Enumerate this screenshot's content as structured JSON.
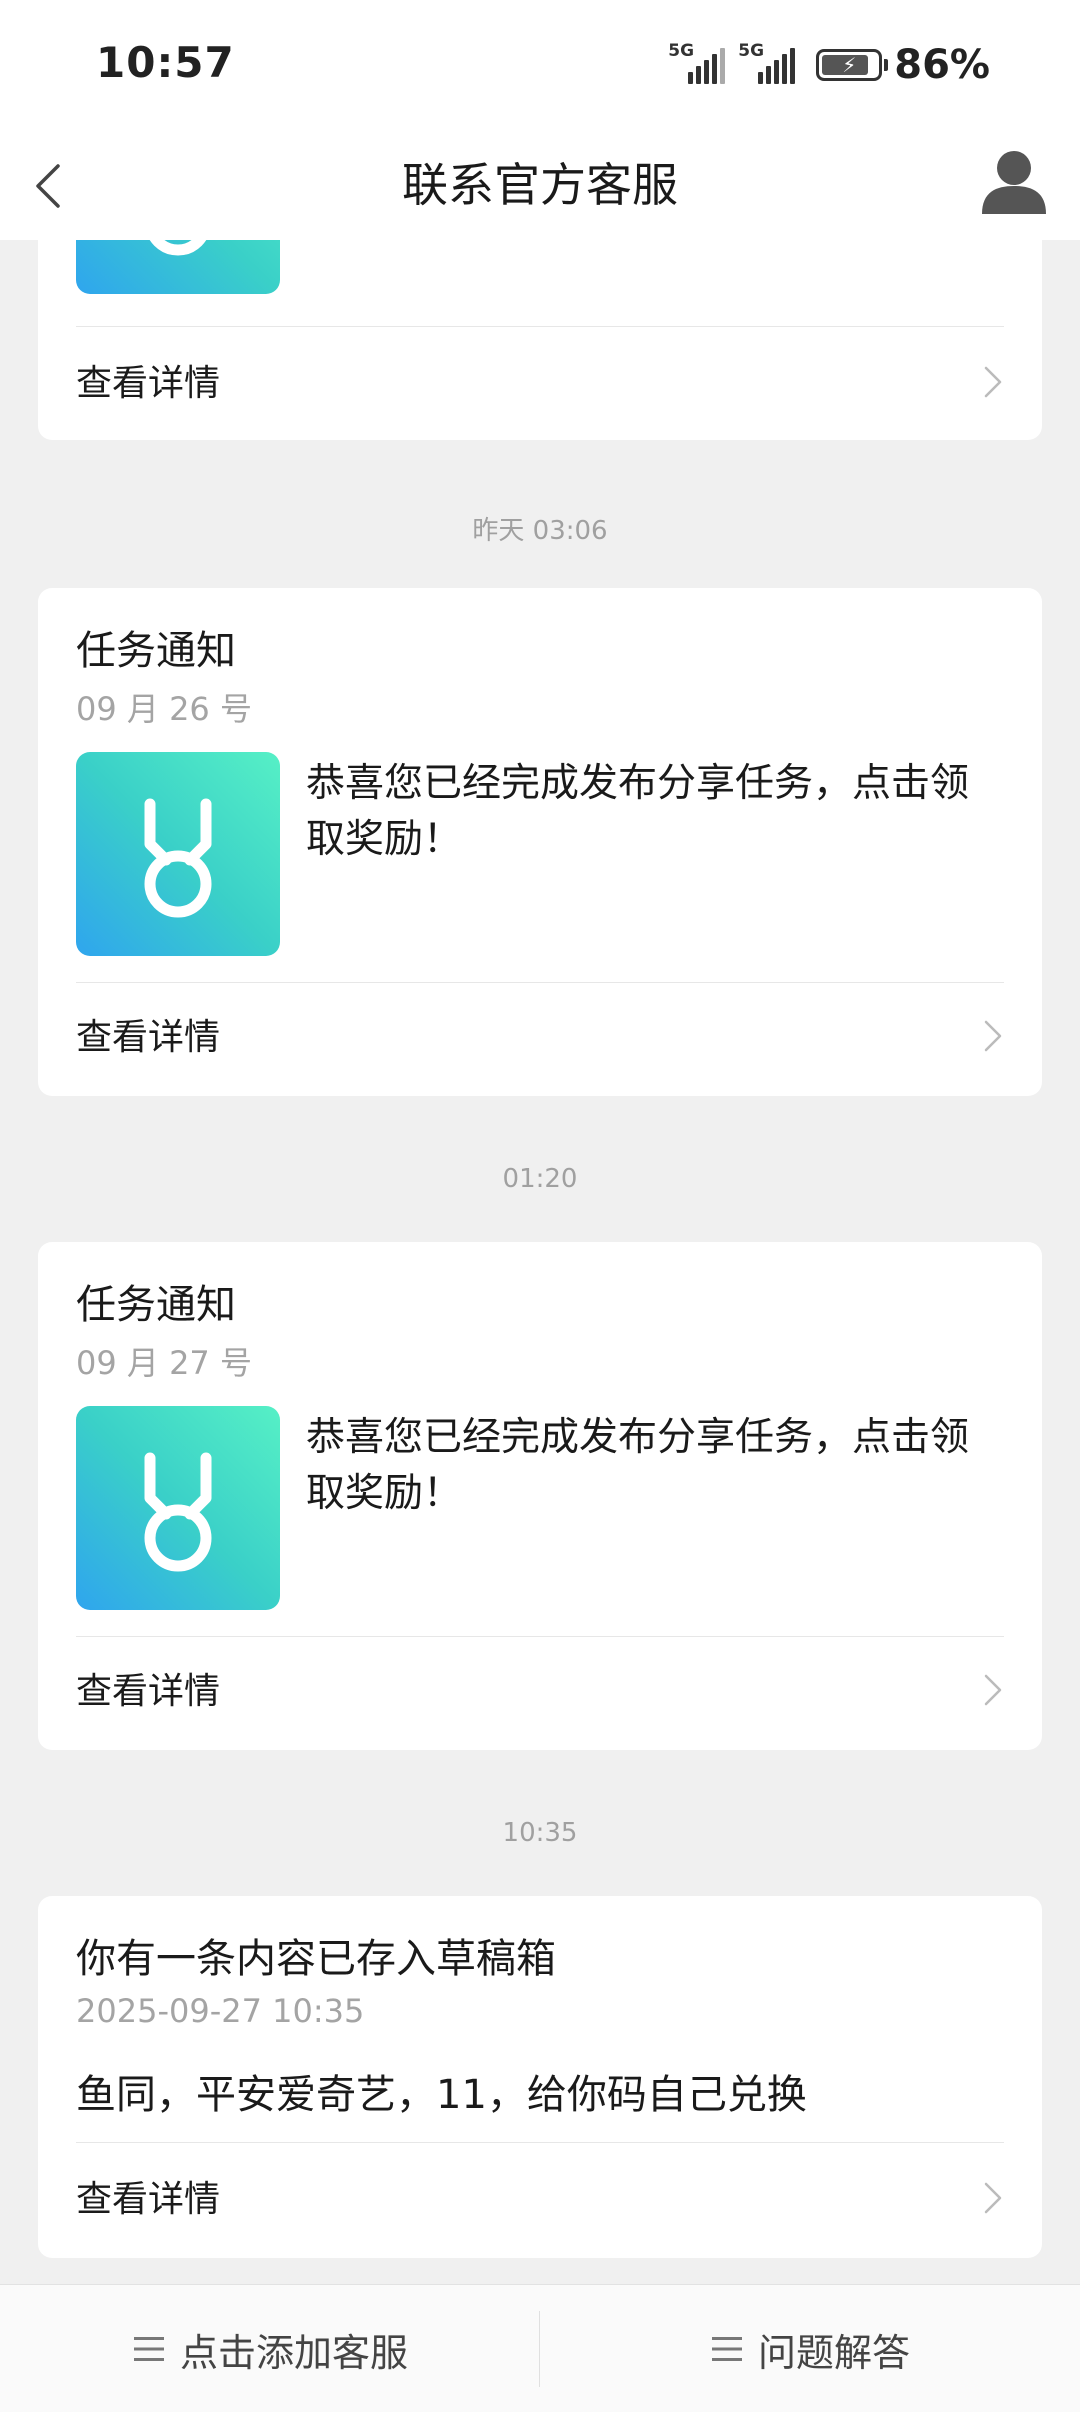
{
  "status_bar": {
    "time": "10:57",
    "sim1": "5G",
    "sim2": "5G",
    "battery_percent": "86%",
    "battery_level": 0.86
  },
  "header": {
    "title": "联系官方客服",
    "back_icon": "chevron-left-icon",
    "user_icon": "user-icon"
  },
  "cards": [
    {
      "detail_label": "查看详情"
    },
    {
      "timestamp": "昨天 03:06",
      "title": "任务通知",
      "date": "09 月 26 号",
      "message": "恭喜您已经完成发布分享任务，点击领取奖励！",
      "thumb_icon": "medal-icon",
      "detail_label": "查看详情"
    },
    {
      "timestamp": "01:20",
      "title": "任务通知",
      "date": "09 月 27 号",
      "message": "恭喜您已经完成发布分享任务，点击领取奖励！",
      "thumb_icon": "medal-icon",
      "detail_label": "查看详情"
    },
    {
      "timestamp": "10:35",
      "title": "你有一条内容已存入草稿箱",
      "date": "2025-09-27 10:35",
      "body": "鱼同，平安爱奇艺，11，给你码自己兑换",
      "detail_label": "查看详情"
    }
  ],
  "bottom_bar": {
    "left_label": "点击添加客服",
    "right_label": "问题解答",
    "icon": "menu-icon"
  },
  "colors": {
    "thumb_gradient_start": "#2fa5ee",
    "thumb_gradient_end": "#56f0c6",
    "background": "#f0f0f0"
  }
}
